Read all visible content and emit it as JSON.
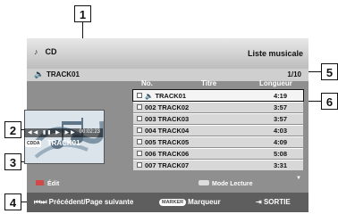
{
  "callouts": [
    "1",
    "2",
    "3",
    "4",
    "5",
    "6"
  ],
  "screen": {
    "source_label": "CD",
    "menu_title": "Liste musicale",
    "current_track": "TRACK01",
    "position": "1/10",
    "thumbnail_time": "00:02:23",
    "cdda_badge": "CDDA",
    "cdda_track": "TRACK01"
  },
  "list_header": {
    "no": "No.",
    "titre": "Titre",
    "longueur": "Longueur"
  },
  "tracks": [
    {
      "no": "",
      "title": "TRACK01",
      "length": "4:19",
      "selected": true
    },
    {
      "no": "002",
      "title": "TRACK02",
      "length": "3:57"
    },
    {
      "no": "003",
      "title": "TRACK03",
      "length": "3:57"
    },
    {
      "no": "004",
      "title": "TRACK04",
      "length": "4:03"
    },
    {
      "no": "005",
      "title": "TRACK05",
      "length": "4:09"
    },
    {
      "no": "006",
      "title": "TRACK06",
      "length": "5:08"
    },
    {
      "no": "007",
      "title": "TRACK07",
      "length": "3:31"
    }
  ],
  "hints": {
    "edit": "Édit",
    "mode": "Mode Lecture"
  },
  "bottom": {
    "prev_next": "Précédent/Page suivante",
    "marker_pill": "MARKER",
    "marker": "Marqueur",
    "exit": "SORTIE"
  },
  "colors": {
    "screen_bg": "#8f8f8f",
    "row_bg": "#d8d8d8",
    "bottom_bg": "#5e5e5e"
  }
}
